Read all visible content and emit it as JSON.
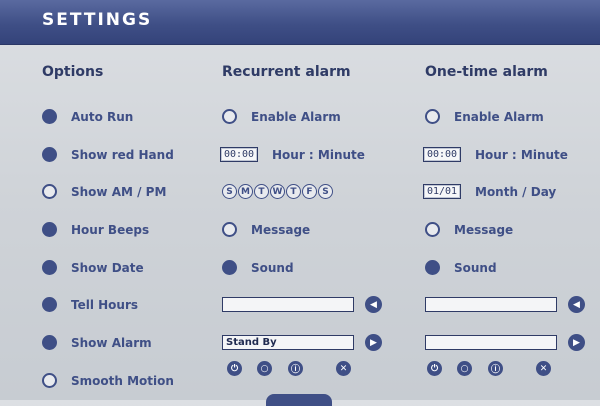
{
  "title": "SETTINGS",
  "options": {
    "header": "Options",
    "items": [
      {
        "label": "Auto Run",
        "checked": true
      },
      {
        "label": "Show red Hand",
        "checked": true
      },
      {
        "label": "Show AM / PM",
        "checked": false
      },
      {
        "label": "Hour Beeps",
        "checked": true
      },
      {
        "label": "Show Date",
        "checked": true
      },
      {
        "label": "Tell Hours",
        "checked": true
      },
      {
        "label": "Show Alarm",
        "checked": true
      },
      {
        "label": "Smooth Motion",
        "checked": false
      }
    ]
  },
  "recurrent": {
    "header": "Recurrent alarm",
    "enable_label": "Enable Alarm",
    "enable_checked": false,
    "time_value": "00:00",
    "time_label": "Hour : Minute",
    "days": [
      "S",
      "M",
      "T",
      "W",
      "T",
      "F",
      "S"
    ],
    "message_label": "Message",
    "message_checked": false,
    "sound_label": "Sound",
    "sound_checked": true,
    "message_field": "",
    "sound_field": "Stand By"
  },
  "onetime": {
    "header": "One-time alarm",
    "enable_label": "Enable Alarm",
    "enable_checked": false,
    "time_value": "00:00",
    "time_label": "Hour : Minute",
    "date_value": "01/01",
    "date_label": "Month / Day",
    "message_label": "Message",
    "message_checked": false,
    "sound_label": "Sound",
    "sound_checked": true,
    "message_field": "",
    "sound_field": ""
  },
  "icons": {
    "rewind": "◀",
    "play": "▶",
    "power": "⏻",
    "circle": "○",
    "info": "ⓘ",
    "close": "✕"
  }
}
